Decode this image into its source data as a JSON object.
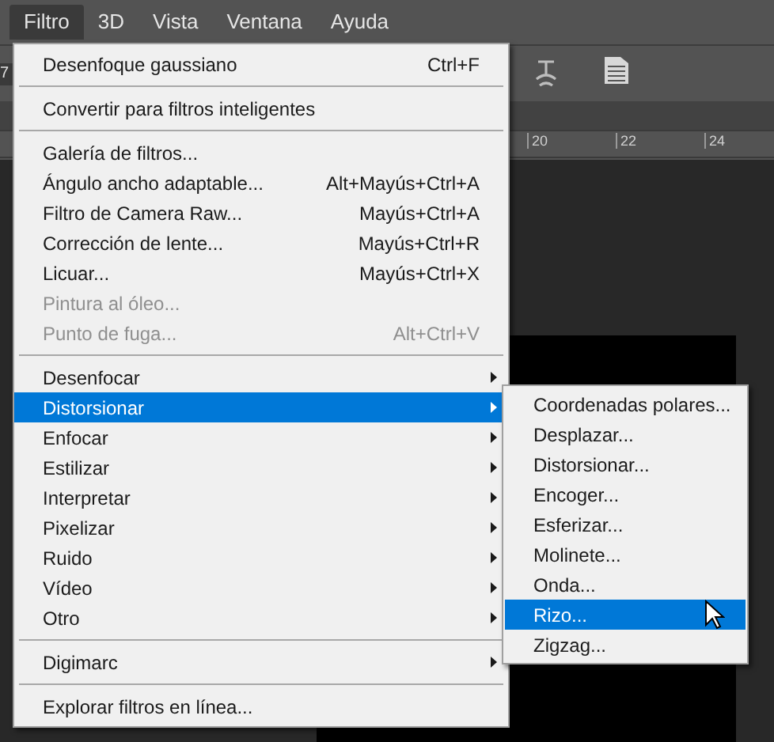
{
  "menubar": [
    {
      "label": "Filtro",
      "selected": true
    },
    {
      "label": "3D",
      "selected": false
    },
    {
      "label": "Vista",
      "selected": false
    },
    {
      "label": "Ventana",
      "selected": false
    },
    {
      "label": "Ayuda",
      "selected": false
    }
  ],
  "toolbar": {
    "field_value": "7"
  },
  "ruler": {
    "labels": [
      "20",
      "22",
      "24"
    ]
  },
  "filter_menu": [
    {
      "kind": "item",
      "label": "Desenfoque gaussiano",
      "shortcut": "Ctrl+F",
      "disabled": false,
      "selected": false,
      "submenu": false
    },
    {
      "kind": "separator"
    },
    {
      "kind": "item",
      "label": "Convertir para filtros inteligentes",
      "disabled": false,
      "selected": false,
      "submenu": false
    },
    {
      "kind": "separator"
    },
    {
      "kind": "item",
      "label": "Galería de filtros...",
      "disabled": false,
      "selected": false,
      "submenu": false
    },
    {
      "kind": "item",
      "label": "Ángulo ancho adaptable...",
      "shortcut": "Alt+Mayús+Ctrl+A",
      "disabled": false,
      "selected": false,
      "submenu": false
    },
    {
      "kind": "item",
      "label": "Filtro de Camera Raw...",
      "shortcut": "Mayús+Ctrl+A",
      "disabled": false,
      "selected": false,
      "submenu": false
    },
    {
      "kind": "item",
      "label": "Corrección de lente...",
      "shortcut": "Mayús+Ctrl+R",
      "disabled": false,
      "selected": false,
      "submenu": false
    },
    {
      "kind": "item",
      "label": "Licuar...",
      "shortcut": "Mayús+Ctrl+X",
      "disabled": false,
      "selected": false,
      "submenu": false
    },
    {
      "kind": "item",
      "label": "Pintura al óleo...",
      "disabled": true,
      "selected": false,
      "submenu": false
    },
    {
      "kind": "item",
      "label": "Punto de fuga...",
      "shortcut": "Alt+Ctrl+V",
      "disabled": true,
      "selected": false,
      "submenu": false
    },
    {
      "kind": "separator"
    },
    {
      "kind": "item",
      "label": "Desenfocar",
      "disabled": false,
      "selected": false,
      "submenu": true
    },
    {
      "kind": "item",
      "label": "Distorsionar",
      "disabled": false,
      "selected": true,
      "submenu": true
    },
    {
      "kind": "item",
      "label": "Enfocar",
      "disabled": false,
      "selected": false,
      "submenu": true
    },
    {
      "kind": "item",
      "label": "Estilizar",
      "disabled": false,
      "selected": false,
      "submenu": true
    },
    {
      "kind": "item",
      "label": "Interpretar",
      "disabled": false,
      "selected": false,
      "submenu": true
    },
    {
      "kind": "item",
      "label": "Pixelizar",
      "disabled": false,
      "selected": false,
      "submenu": true
    },
    {
      "kind": "item",
      "label": "Ruido",
      "disabled": false,
      "selected": false,
      "submenu": true
    },
    {
      "kind": "item",
      "label": "Vídeo",
      "disabled": false,
      "selected": false,
      "submenu": true
    },
    {
      "kind": "item",
      "label": "Otro",
      "disabled": false,
      "selected": false,
      "submenu": true
    },
    {
      "kind": "separator"
    },
    {
      "kind": "item",
      "label": "Digimarc",
      "disabled": false,
      "selected": false,
      "submenu": true
    },
    {
      "kind": "separator"
    },
    {
      "kind": "item",
      "label": "Explorar filtros en línea...",
      "disabled": false,
      "selected": false,
      "submenu": false
    }
  ],
  "distorsionar_submenu": [
    {
      "label": "Coordenadas polares...",
      "selected": false
    },
    {
      "label": "Desplazar...",
      "selected": false
    },
    {
      "label": "Distorsionar...",
      "selected": false
    },
    {
      "label": "Encoger...",
      "selected": false
    },
    {
      "label": "Esferizar...",
      "selected": false
    },
    {
      "label": "Molinete...",
      "selected": false
    },
    {
      "label": "Onda...",
      "selected": false
    },
    {
      "label": "Rizo...",
      "selected": true
    },
    {
      "label": "Zigzag...",
      "selected": false
    }
  ]
}
